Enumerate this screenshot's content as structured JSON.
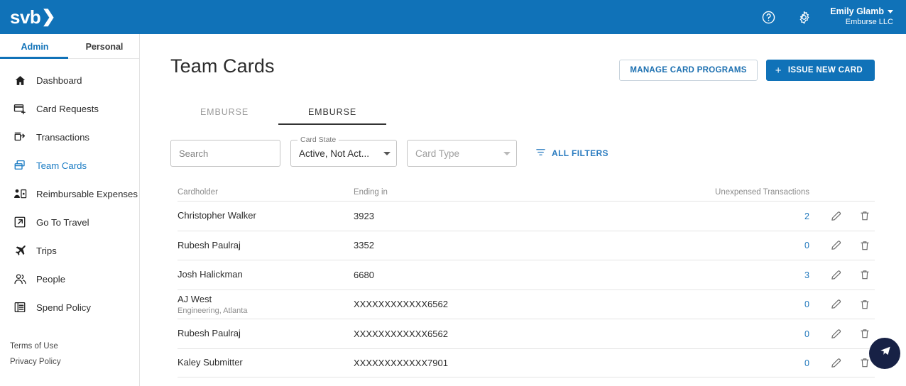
{
  "topbar": {
    "logo_text": "svb",
    "logo_chevron": "❯",
    "help_icon": "help-circle-icon",
    "settings_icon": "gear-icon",
    "user_name": "Emily Glamb",
    "user_org": "Emburse LLC"
  },
  "sidebar": {
    "tabs": [
      {
        "label": "Admin",
        "active": true
      },
      {
        "label": "Personal",
        "active": false
      }
    ],
    "items": [
      {
        "label": "Dashboard",
        "icon": "home-icon",
        "active": false
      },
      {
        "label": "Card Requests",
        "icon": "card-plus-icon",
        "active": false
      },
      {
        "label": "Transactions",
        "icon": "transactions-icon",
        "active": false
      },
      {
        "label": "Team Cards",
        "icon": "team-cards-icon",
        "active": true
      },
      {
        "label": "Reimbursable Expenses",
        "icon": "person-receipt-icon",
        "active": false
      },
      {
        "label": "Go To Travel",
        "icon": "external-link-icon",
        "active": false
      },
      {
        "label": "Trips",
        "icon": "airplane-icon",
        "active": false
      },
      {
        "label": "People",
        "icon": "people-icon",
        "active": false
      },
      {
        "label": "Spend Policy",
        "icon": "spend-policy-icon",
        "active": false
      }
    ],
    "legal": [
      {
        "label": "Terms of Use"
      },
      {
        "label": "Privacy Policy"
      }
    ]
  },
  "main": {
    "page_title": "Team Cards",
    "actions": {
      "manage_label": "MANAGE CARD PROGRAMS",
      "issue_label": "ISSUE NEW CARD",
      "issue_plus": "+"
    },
    "tabs": [
      {
        "label": "EMBURSE",
        "active": false
      },
      {
        "label": "EMBURSE",
        "active": true
      }
    ],
    "filters": {
      "search_placeholder": "Search",
      "search_value": "",
      "search_icon": "search-icon",
      "card_state_legend": "Card State",
      "card_state_value": "Active, Not Act...",
      "card_type_placeholder": "Card Type",
      "all_filters_label": "ALL FILTERS",
      "all_filters_icon": "filter-icon"
    },
    "table": {
      "headers": {
        "cardholder": "Cardholder",
        "ending_in": "Ending in",
        "unexpensed": "Unexpensed Transactions"
      },
      "rows": [
        {
          "cardholder": "Christopher Walker",
          "sub": "",
          "ending_in": "3923",
          "unexpensed": "2"
        },
        {
          "cardholder": "Rubesh Paulraj",
          "sub": "",
          "ending_in": "3352",
          "unexpensed": "0"
        },
        {
          "cardholder": "Josh Halickman",
          "sub": "",
          "ending_in": "6680",
          "unexpensed": "3"
        },
        {
          "cardholder": "AJ West",
          "sub": "Engineering, Atlanta",
          "ending_in": "XXXXXXXXXXXX6562",
          "unexpensed": "0"
        },
        {
          "cardholder": "Rubesh Paulraj",
          "sub": "",
          "ending_in": "XXXXXXXXXXXX6562",
          "unexpensed": "0"
        },
        {
          "cardholder": "Kaley Submitter",
          "sub": "",
          "ending_in": "XXXXXXXXXXXX7901",
          "unexpensed": "0"
        }
      ],
      "row_actions": {
        "edit_icon": "pencil-icon",
        "delete_icon": "trash-icon"
      }
    },
    "fab": {
      "icon": "paper-plane-icon"
    }
  },
  "colors": {
    "brand_blue": "#1072b8",
    "link_blue": "#2279bd",
    "fab_navy": "#172145"
  }
}
